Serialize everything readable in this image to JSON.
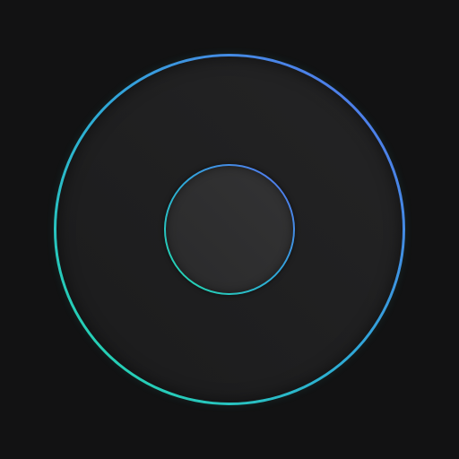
{
  "colors": {
    "background": "#121213",
    "ring_gradient_start": "#22e0a8",
    "ring_gradient_mid": "#2fa8d8",
    "ring_gradient_end": "#5a6ef0",
    "outer_face_start": "#1b1b1c",
    "outer_face_end": "#242425",
    "inner_face_start": "#2a2a2b",
    "inner_face_end": "#333334"
  },
  "dial": {
    "icon": "circular-dial-knob"
  }
}
